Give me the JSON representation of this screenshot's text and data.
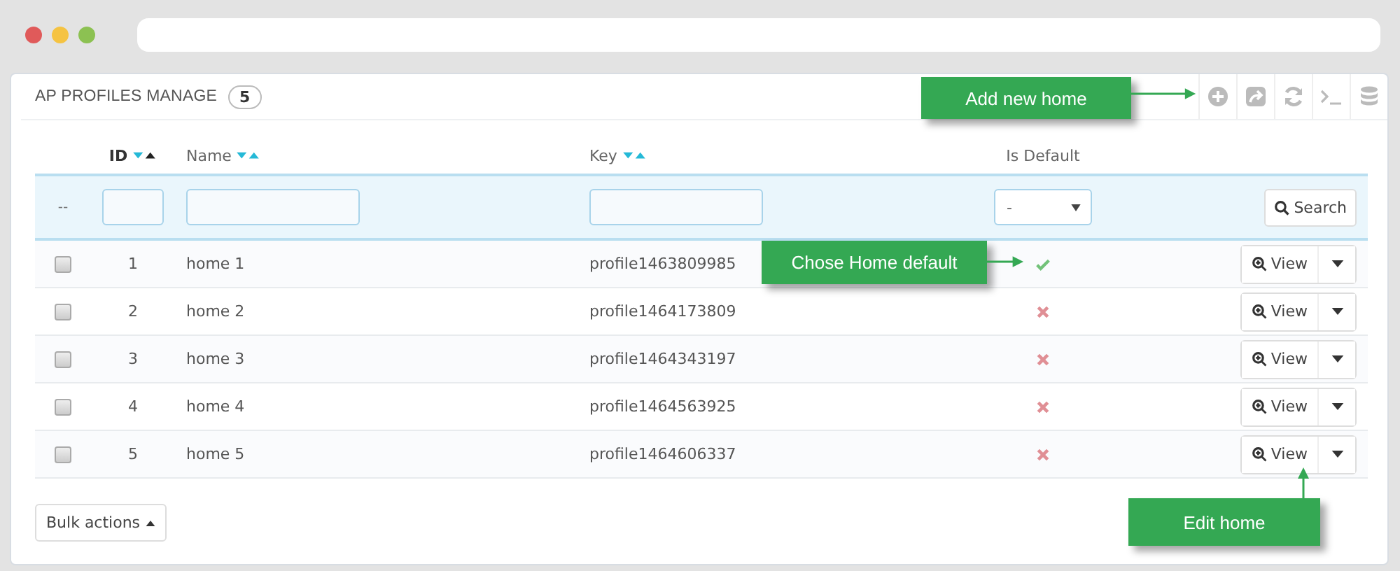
{
  "panel": {
    "title": "AP PROFILES MANAGE",
    "count": "5"
  },
  "columns": [
    {
      "label": "ID",
      "sorted_ascending": true
    },
    {
      "label": "Name",
      "sorted_ascending": false
    },
    {
      "label": "Key",
      "sorted_ascending": false
    },
    {
      "label": "Is Default"
    }
  ],
  "filters": {
    "reset": "--",
    "is_default": "-",
    "search_button": "Search"
  },
  "rows": [
    {
      "checked": false,
      "id": "1",
      "name": "home 1",
      "key": "profile1463809985",
      "is_default": true,
      "action": "View"
    },
    {
      "checked": false,
      "id": "2",
      "name": "home 2",
      "key": "profile1464173809",
      "is_default": false,
      "action": "View"
    },
    {
      "checked": false,
      "id": "3",
      "name": "home 3",
      "key": "profile1464343197",
      "is_default": false,
      "action": "View"
    },
    {
      "checked": false,
      "id": "4",
      "name": "home 4",
      "key": "profile1464563925",
      "is_default": false,
      "action": "View"
    },
    {
      "checked": false,
      "id": "5",
      "name": "home 5",
      "key": "profile1464606337",
      "is_default": false,
      "action": "View"
    }
  ],
  "bulk_actions": "Bulk actions",
  "callouts": [
    "Add new home",
    "Chose Home default",
    "Edit home"
  ]
}
